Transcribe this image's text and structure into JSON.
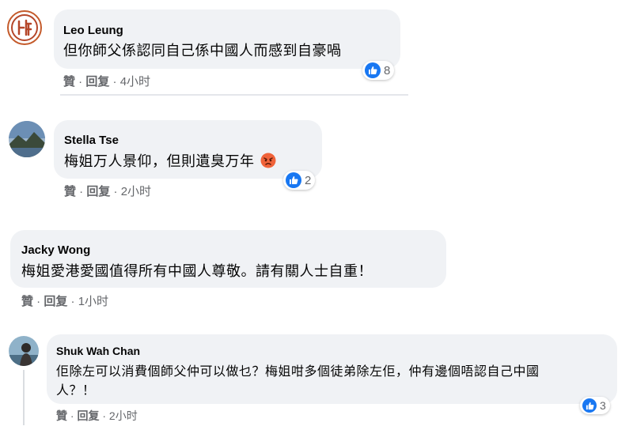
{
  "comments": [
    {
      "author": "Leo Leung",
      "text": "但你師父係認同自己係中國人而感到自豪喎",
      "like_label": "贊",
      "reply_label": "回复",
      "time": "4小时",
      "reaction_count": "8",
      "avatar_color": "#c45a2a"
    },
    {
      "author": "Stella Tse",
      "text": "梅姐万人景仰，但則遺臭万年",
      "like_label": "贊",
      "reply_label": "回复",
      "time": "2小时",
      "reaction_count": "2",
      "avatar_color": "#5b7fa6"
    },
    {
      "author": "Jacky Wong",
      "text": "梅姐愛港愛國值得所有中國人尊敬。請有關人士自重！",
      "like_label": "贊",
      "reply_label": "回复",
      "time": "1小时"
    },
    {
      "author": "Shuk Wah Chan",
      "text_line1": "佢除左可以消費個師父仲可以做乜？梅姐咁多個徒弟除左佢，仲有邊個唔認自己中國",
      "text_line2": "人？！",
      "like_label": "贊",
      "reply_label": "回复",
      "time": "2小时",
      "reaction_count": "3",
      "avatar_color": "#7aa0b8"
    }
  ],
  "colors": {
    "bubble": "#f0f2f5",
    "like_blue": "#1877f2",
    "angry": "#f0633a",
    "meta_text": "#65676b"
  }
}
